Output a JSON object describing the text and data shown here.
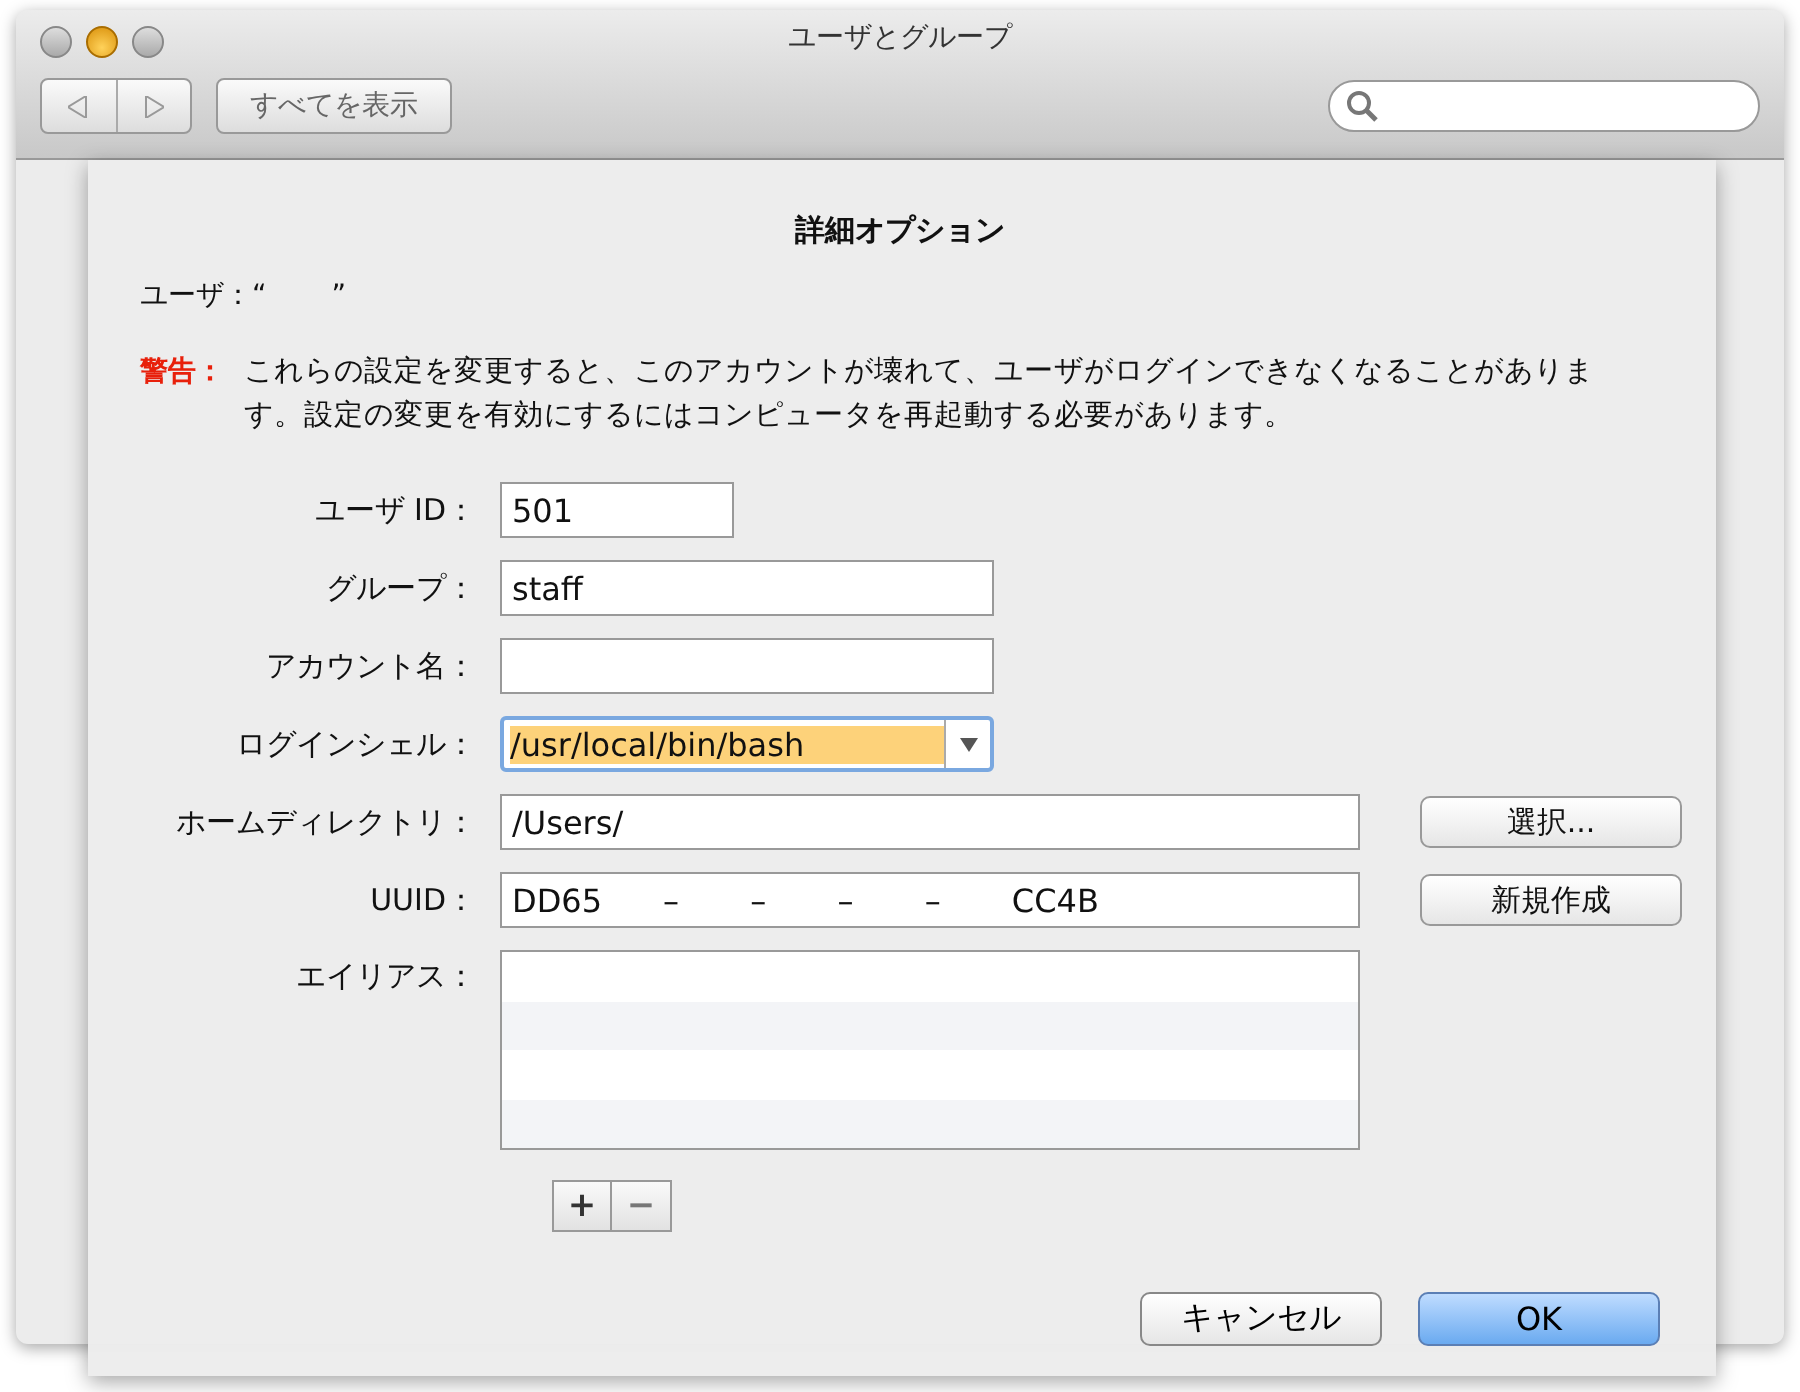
{
  "window": {
    "title": "ユーザとグループ",
    "show_all": "すべてを表示"
  },
  "sheet": {
    "title": "詳細オプション",
    "user_line": "ユーザ：“　　 ”",
    "warning_label": "警告：",
    "warning_text": "これらの設定を変更すると、このアカウントが壊れて、ユーザがログインできなくなることがあります。設定の変更を有効にするにはコンピュータを再起動する必要があります。",
    "fields": [
      {
        "kind": "short",
        "label": "ユーザ ID：",
        "value": "501"
      },
      {
        "kind": "medium",
        "label": "グループ：",
        "value": "staff"
      },
      {
        "kind": "medium",
        "label": "アカウント名："
      },
      {
        "kind": "combo",
        "label": "ログインシェル：",
        "value": "/usr/local/bin/bash",
        "selected": true
      },
      {
        "kind": "wide",
        "label": "ホームディレクトリ：",
        "value": "/Users/",
        "button": "選択..."
      },
      {
        "kind": "wide",
        "label": "UUID：",
        "value": "DD65      –       –       –       –       CC4B",
        "button": "新規作成"
      },
      {
        "kind": "list",
        "label": "エイリアス："
      }
    ],
    "add": "+",
    "remove": "−",
    "cancel": "キャンセル",
    "ok": "OK"
  }
}
